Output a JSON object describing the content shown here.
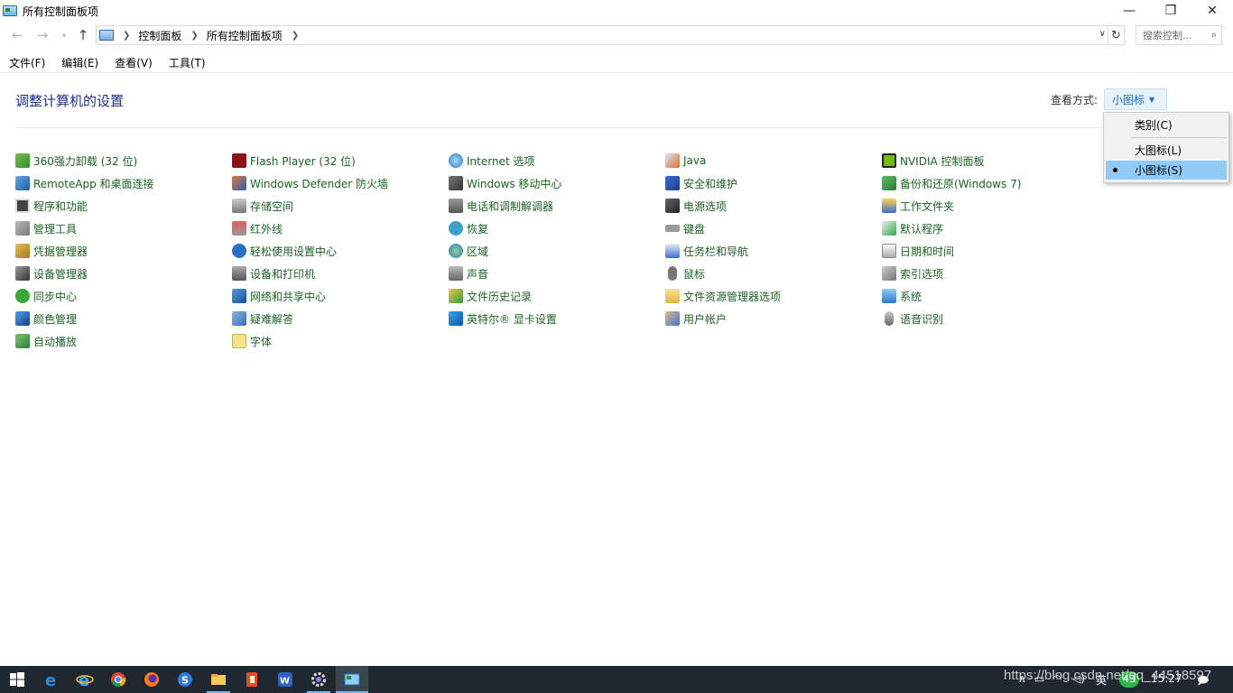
{
  "window": {
    "title": "所有控制面板项"
  },
  "address": {
    "breadcrumbs": [
      "控制面板",
      "所有控制面板项"
    ],
    "search_placeholder": "搜索控制..."
  },
  "menubar": [
    "文件(F)",
    "编辑(E)",
    "查看(V)",
    "工具(T)"
  ],
  "content": {
    "title": "调整计算机的设置",
    "view_by_label": "查看方式:",
    "view_by_value": "小图标"
  },
  "view_options": [
    {
      "label": "类别(C)",
      "selected": false
    },
    {
      "label": "大图标(L)",
      "selected": false
    },
    {
      "label": "小图标(S)",
      "selected": true
    }
  ],
  "columns": [
    [
      {
        "label": "360强力卸载 (32 位)",
        "icon": "uninstall-icon"
      },
      {
        "label": "RemoteApp 和桌面连接",
        "icon": "remoteapp-icon"
      },
      {
        "label": "程序和功能",
        "icon": "programs-icon"
      },
      {
        "label": "管理工具",
        "icon": "admin-tools-icon"
      },
      {
        "label": "凭据管理器",
        "icon": "credential-icon"
      },
      {
        "label": "设备管理器",
        "icon": "device-manager-icon"
      },
      {
        "label": "同步中心",
        "icon": "sync-icon"
      },
      {
        "label": "颜色管理",
        "icon": "color-icon"
      },
      {
        "label": "自动播放",
        "icon": "autoplay-icon"
      }
    ],
    [
      {
        "label": "Flash Player (32 位)",
        "icon": "flash-icon"
      },
      {
        "label": "Windows Defender 防火墙",
        "icon": "firewall-icon"
      },
      {
        "label": "存储空间",
        "icon": "storage-icon"
      },
      {
        "label": "红外线",
        "icon": "infrared-icon"
      },
      {
        "label": "轻松使用设置中心",
        "icon": "ease-of-access-icon"
      },
      {
        "label": "设备和打印机",
        "icon": "printer-icon"
      },
      {
        "label": "网络和共享中心",
        "icon": "network-icon"
      },
      {
        "label": "疑难解答",
        "icon": "troubleshoot-icon"
      },
      {
        "label": "字体",
        "icon": "font-icon"
      }
    ],
    [
      {
        "label": "Internet 选项",
        "icon": "internet-icon"
      },
      {
        "label": "Windows 移动中心",
        "icon": "mobility-icon"
      },
      {
        "label": "电话和调制解调器",
        "icon": "phone-icon"
      },
      {
        "label": "恢复",
        "icon": "recovery-icon"
      },
      {
        "label": "区域",
        "icon": "region-icon"
      },
      {
        "label": "声音",
        "icon": "sound-icon"
      },
      {
        "label": "文件历史记录",
        "icon": "file-history-icon"
      },
      {
        "label": "英特尔® 显卡设置",
        "icon": "intel-graphics-icon"
      }
    ],
    [
      {
        "label": "Java",
        "icon": "java-icon"
      },
      {
        "label": "安全和维护",
        "icon": "security-flag-icon"
      },
      {
        "label": "电源选项",
        "icon": "power-icon"
      },
      {
        "label": "键盘",
        "icon": "keyboard-icon"
      },
      {
        "label": "任务栏和导航",
        "icon": "taskbar-icon"
      },
      {
        "label": "鼠标",
        "icon": "mouse-icon"
      },
      {
        "label": "文件资源管理器选项",
        "icon": "folder-options-icon"
      },
      {
        "label": "用户帐户",
        "icon": "users-icon"
      }
    ],
    [
      {
        "label": "NVIDIA 控制面板",
        "icon": "nvidia-icon"
      },
      {
        "label": "备份和还原(Windows 7)",
        "icon": "backup-icon"
      },
      {
        "label": "工作文件夹",
        "icon": "work-folders-icon"
      },
      {
        "label": "默认程序",
        "icon": "default-programs-icon"
      },
      {
        "label": "日期和时间",
        "icon": "datetime-icon"
      },
      {
        "label": "索引选项",
        "icon": "indexing-icon"
      },
      {
        "label": "系统",
        "icon": "system-icon"
      },
      {
        "label": "语音识别",
        "icon": "speech-icon"
      }
    ]
  ],
  "taskbar": {
    "tray_lang": "英",
    "tray_badge": "43",
    "clock": "15:27",
    "watermark": "https://blog.csdn.net/qq_44518597"
  },
  "colors": {
    "item_text": "#1a6323",
    "title_text": "#1e3287",
    "selection": "#91c9f7",
    "taskbar": "#1f2730"
  }
}
